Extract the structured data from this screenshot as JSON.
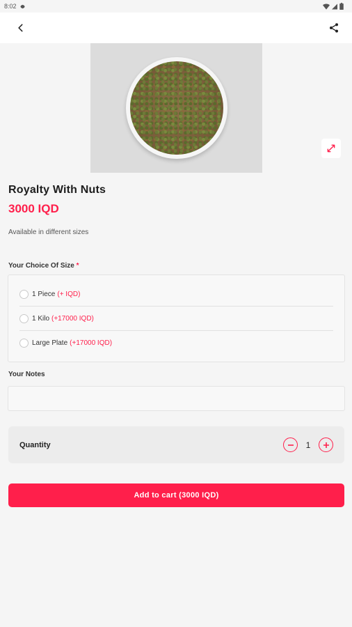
{
  "status_bar": {
    "time": "8:02",
    "icons": [
      "settings-icon",
      "wifi-icon",
      "signal-icon",
      "battery-icon"
    ]
  },
  "app_bar": {
    "back_icon": "back-arrow-icon",
    "share_icon": "share-icon"
  },
  "product": {
    "image_icon": "expand-icon",
    "title": "Royalty With Nuts",
    "price": "3000 IQD",
    "description": "Available in different sizes"
  },
  "size_choice": {
    "label": "Your Choice Of Size",
    "required_mark": "*",
    "options": [
      {
        "name": "1 Piece",
        "price": "(+ IQD)"
      },
      {
        "name": "1 Kilo",
        "price": "(+17000 IQD)"
      },
      {
        "name": "Large Plate",
        "price": "(+17000 IQD)"
      }
    ]
  },
  "notes": {
    "label": "Your Notes",
    "placeholder": ""
  },
  "quantity": {
    "label": "Quantity",
    "value": "1",
    "minus_icon": "minus-circle-icon",
    "plus_icon": "plus-circle-icon"
  },
  "cart_button": {
    "label": "Add to cart (3000 IQD)"
  },
  "colors": {
    "accent": "#ff1f4b",
    "background": "#f5f5f5"
  }
}
